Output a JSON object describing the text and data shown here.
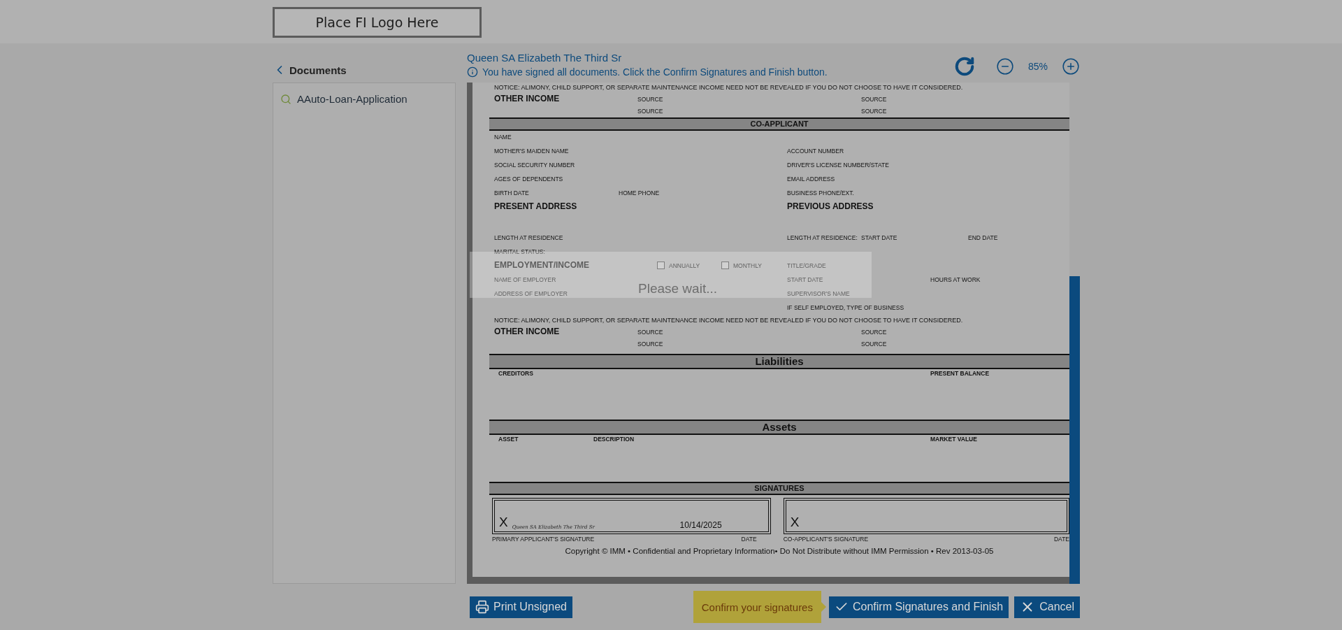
{
  "header": {
    "logo_text": "Place FI Logo Here"
  },
  "sidebar": {
    "back_label": "Documents",
    "documents": [
      {
        "label": "AAuto-Loan-Application"
      }
    ]
  },
  "signer_name": "Queen SA Elizabeth The Third Sr",
  "info_message": "You have signed all documents. Click the Confirm Signatures and Finish button.",
  "zoom": {
    "level_text": "85%"
  },
  "document": {
    "rows": [
      {
        "kind": "notice",
        "text": "NOTICE: ALIMONY, CHILD SUPPORT, OR SEPARATE MAINTENANCE INCOME NEED NOT BE REVEALED IF YOU DO NOT CHOOSE TO HAVE IT CONSIDERED."
      },
      {
        "kind": "compact",
        "column_1": {
          "kind": "heading",
          "text": "OTHER INCOME"
        },
        "column_4": {
          "kind": "label",
          "text": "SOURCE"
        },
        "column_8": {
          "kind": "label",
          "text": "SOURCE"
        }
      },
      {
        "kind": "compact",
        "column_4": {
          "kind": "label",
          "text": "SOURCE"
        },
        "column_8": {
          "kind": "label",
          "text": "SOURCE"
        }
      },
      {
        "kind": "minor_bar",
        "text": "CO-APPLICANT"
      },
      {
        "kind": "fields",
        "column_1": {
          "kind": "label",
          "text": "NAME"
        }
      },
      {
        "kind": "fields",
        "column_1": {
          "kind": "label",
          "text": "MOTHER'S MAIDEN NAME"
        },
        "column_7": {
          "kind": "label",
          "text": "ACCOUNT NUMBER"
        }
      },
      {
        "kind": "fields",
        "column_1": {
          "kind": "label",
          "text": "SOCIAL SECURITY NUMBER"
        },
        "column_7": {
          "kind": "label",
          "text": "DRIVER'S LICENSE NUMBER/STATE"
        }
      },
      {
        "kind": "fields",
        "column_1": {
          "kind": "label",
          "text": "AGES OF DEPENDENTS"
        },
        "column_7": {
          "kind": "label",
          "text": "EMAIL ADDRESS"
        }
      },
      {
        "kind": "fields",
        "column_1": {
          "kind": "label",
          "text": "BIRTH DATE"
        },
        "column_3": {
          "kind": "label",
          "text": "HOME PHONE"
        },
        "column_7": {
          "kind": "label",
          "text": "BUSINESS PHONE/EXT."
        }
      },
      {
        "kind": "address",
        "column_1": {
          "kind": "heading",
          "text": "PRESENT ADDRESS"
        },
        "column_7": {
          "kind": "heading",
          "text": "PREVIOUS ADDRESS"
        }
      },
      {
        "kind": "fields",
        "column_1": {
          "kind": "label",
          "text": "LENGTH AT RESIDENCE"
        },
        "column_7": {
          "kind": "label",
          "text": "LENGTH AT RESIDENCE:"
        },
        "column_8": {
          "kind": "label",
          "text": "START DATE"
        },
        "column_10": {
          "kind": "label",
          "text": "END DATE"
        }
      },
      {
        "kind": "fields",
        "column_1": {
          "kind": "label",
          "text": "MARITAL STATUS:"
        }
      },
      {
        "kind": "fields",
        "column_1": {
          "kind": "heading",
          "text": "EMPLOYMENT/INCOME"
        },
        "column_5": {
          "kind": "checkbox",
          "text": "ANNUALLY",
          "checked": false
        },
        "column_6": {
          "kind": "checkbox",
          "text": "MONTHLY",
          "checked": false
        },
        "column_7": {
          "kind": "label",
          "text": "TITLE/GRADE"
        }
      },
      {
        "kind": "fields",
        "column_1": {
          "kind": "label",
          "text": "NAME OF EMPLOYER"
        },
        "column_7": {
          "kind": "label",
          "text": "START DATE"
        },
        "column_9": {
          "kind": "label",
          "text": "HOURS AT WORK"
        }
      },
      {
        "kind": "fields",
        "column_1": {
          "kind": "label",
          "text": "ADDRESS OF EMPLOYER"
        },
        "column_7": {
          "kind": "label",
          "text": "SUPERVISOR'S NAME"
        }
      },
      {
        "kind": "fields",
        "column_7": {
          "kind": "label",
          "text": "IF SELF EMPLOYED, TYPE OF BUSINESS"
        }
      },
      {
        "kind": "notice",
        "text": "NOTICE: ALIMONY, CHILD SUPPORT, OR SEPARATE MAINTENANCE INCOME NEED NOT BE REVEALED IF YOU DO NOT CHOOSE TO HAVE IT CONSIDERED."
      },
      {
        "kind": "compact",
        "column_1": {
          "kind": "heading",
          "text": "OTHER INCOME"
        },
        "column_4": {
          "kind": "label",
          "text": "SOURCE"
        },
        "column_8": {
          "kind": "label",
          "text": "SOURCE"
        }
      },
      {
        "kind": "compact",
        "column_4": {
          "kind": "label",
          "text": "SOURCE"
        },
        "column_8": {
          "kind": "label",
          "text": "SOURCE"
        }
      },
      {
        "kind": "major_bar",
        "text": "Liabilities"
      },
      {
        "kind": "table_header",
        "column_1": {
          "kind": "column_header",
          "text": "CREDITORS"
        },
        "column_9": {
          "kind": "column_header",
          "text": "PRESENT BALANCE"
        }
      },
      {
        "kind": "major_bar",
        "text": "Assets"
      },
      {
        "kind": "table_header",
        "column_1": {
          "kind": "column_header",
          "text": "ASSET"
        },
        "column_2": {
          "kind": "column_header",
          "text": "DESCRIPTION"
        },
        "column_9": {
          "kind": "column_header",
          "text": "MARKET VALUE"
        }
      },
      {
        "kind": "minor_bar",
        "text": "SIGNATURES"
      },
      {
        "kind": "signatures",
        "boxes": [
          {
            "mark": "X",
            "signature": "Queen SA Elizabeth The Third Sr",
            "date": "10/14/2025",
            "label": "PRIMARY APPLICANT'S SIGNATURE",
            "date_label": "DATE"
          },
          {
            "mark": "X",
            "label": "CO-APPLICANT'S SIGNATURE",
            "date_label": "DATE"
          }
        ]
      },
      {
        "kind": "copyright",
        "text": "Copyright © IMM • Confidential and Proprietary Information• Do Not Distribute without IMM Permission • Rev 2013-03-05"
      }
    ]
  },
  "loading": {
    "text": "Please wait..."
  },
  "footer": {
    "print_button": "Print Unsigned",
    "hint": "Confirm your signatures",
    "confirm_button": "Confirm Signatures and Finish",
    "cancel_button": "Cancel"
  }
}
